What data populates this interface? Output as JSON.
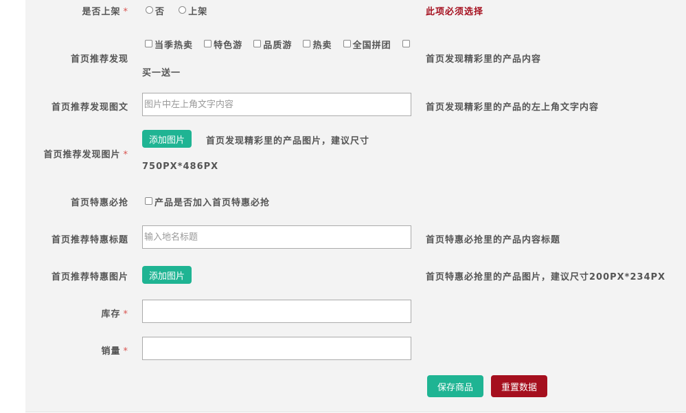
{
  "form": {
    "on_shelf": {
      "label": "是否上架",
      "required_mark": "*",
      "options": [
        "否",
        "上架"
      ],
      "error": "此项必须选择"
    },
    "home_discover": {
      "label": "首页推荐发现",
      "options": [
        "当季热卖",
        "特色游",
        "品质游",
        "热卖",
        "全国拼团",
        "买一送一"
      ],
      "hint": "首页发现精彩里的产品内容"
    },
    "home_discover_text": {
      "label": "首页推荐发现图文",
      "placeholder": "图片中左上角文字内容",
      "value": "",
      "hint": "首页发现精彩里的产品的左上角文字内容"
    },
    "home_discover_image": {
      "label": "首页推荐发现图片",
      "required_mark": "*",
      "button": "添加图片",
      "hint_line1": "首页发现精彩里的产品图片，建议尺寸",
      "hint_line2": "750PX*486PX"
    },
    "home_flash_sale": {
      "label": "首页特惠必抢",
      "option": "产品是否加入首页特惠必抢"
    },
    "home_flash_title": {
      "label": "首页推荐特惠标题",
      "placeholder": "输入地名标题",
      "value": "",
      "hint": "首页特惠必抢里的产品内容标题"
    },
    "home_flash_image": {
      "label": "首页推荐特惠图片",
      "button": "添加图片",
      "hint": "首页特惠必抢里的产品图片，建议尺寸200PX*234PX"
    },
    "stock": {
      "label": "库存",
      "required_mark": "*",
      "value": ""
    },
    "sales": {
      "label": "销量",
      "required_mark": "*",
      "value": ""
    },
    "actions": {
      "save": "保存商品",
      "reset": "重置数据"
    }
  },
  "colors": {
    "teal": "#1fb493",
    "dark_red": "#a50f1e",
    "required": "#d9534f"
  }
}
